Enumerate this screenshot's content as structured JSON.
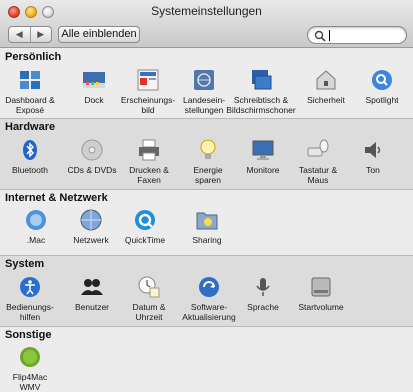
{
  "window": {
    "title": "Systemeinstellungen"
  },
  "toolbar": {
    "back": "◀",
    "forward": "▶",
    "show_all": "Alle einblenden",
    "search_value": ""
  },
  "sections": {
    "personal": {
      "title": "Persönlich",
      "items": [
        "Dashboard &\nExposé",
        "Dock",
        "Erscheinungs-\nbild",
        "Landesein-\nstellungen",
        "Schreibtisch &\nBildschirmschoner",
        "Sicherheit",
        "Spotlight"
      ]
    },
    "hardware": {
      "title": "Hardware",
      "items": [
        "Bluetooth",
        "CDs & DVDs",
        "Drucken &\nFaxen",
        "Energie\nsparen",
        "Monitore",
        "Tastatur &\nMaus",
        "Ton"
      ]
    },
    "internet": {
      "title": "Internet & Netzwerk",
      "items": [
        ".Mac",
        "Netzwerk",
        "QuickTime",
        "Sharing"
      ]
    },
    "system": {
      "title": "System",
      "items": [
        "Bedienungs-\nhilfen",
        "Benutzer",
        "Datum &\nUhrzeit",
        "Software-\nAktualisierung",
        "Sprache",
        "Startvolume"
      ]
    },
    "other": {
      "title": "Sonstige",
      "items": [
        "Flip4Mac\nWMV"
      ]
    }
  },
  "icons": {
    "personal": [
      "dashboard-icon",
      "dock-icon",
      "appearance-icon",
      "international-icon",
      "desktop-icon",
      "security-icon",
      "spotlight-icon"
    ],
    "hardware": [
      "bluetooth-icon",
      "cd-dvd-icon",
      "printer-icon",
      "energy-bulb-icon",
      "monitor-icon",
      "keyboard-mouse-icon",
      "speaker-icon"
    ],
    "internet": [
      "mac-icon",
      "network-icon",
      "quicktime-icon",
      "sharing-icon"
    ],
    "system": [
      "accessibility-icon",
      "accounts-icon",
      "date-time-icon",
      "software-update-icon",
      "speech-icon",
      "startup-disk-icon"
    ],
    "other": [
      "flip4mac-icon"
    ]
  }
}
